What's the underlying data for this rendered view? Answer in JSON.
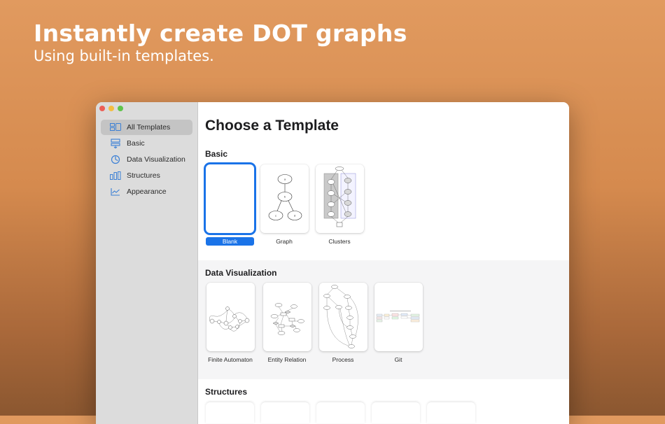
{
  "hero": {
    "title": "Instantly create DOT graphs",
    "subtitle": "Using built-in templates."
  },
  "colors": {
    "accent": "#1a73e8",
    "sidebar_icon": "#3a7fd5",
    "traffic_red": "#ec5f56",
    "traffic_yellow": "#f4be41",
    "traffic_green": "#5fc44b"
  },
  "sidebar": {
    "items": [
      {
        "label": "All Templates",
        "icon": "all-templates-icon",
        "selected": true
      },
      {
        "label": "Basic",
        "icon": "basic-icon",
        "selected": false
      },
      {
        "label": "Data Visualization",
        "icon": "clock-chart-icon",
        "selected": false
      },
      {
        "label": "Structures",
        "icon": "structures-icon",
        "selected": false
      },
      {
        "label": "Appearance",
        "icon": "line-chart-icon",
        "selected": false
      }
    ]
  },
  "main": {
    "title": "Choose a Template",
    "sections": [
      {
        "title": "Basic",
        "templates": [
          {
            "label": "Blank",
            "selected": true
          },
          {
            "label": "Graph",
            "selected": false,
            "nodes": [
              "a",
              "b",
              "c",
              "d"
            ]
          },
          {
            "label": "Clusters",
            "selected": false
          }
        ]
      },
      {
        "title": "Data Visualization",
        "templates": [
          {
            "label": "Finite Automaton",
            "selected": false
          },
          {
            "label": "Entity Relation",
            "selected": false
          },
          {
            "label": "Process",
            "selected": false
          },
          {
            "label": "Git",
            "selected": false
          }
        ]
      },
      {
        "title": "Structures",
        "templates": []
      }
    ]
  }
}
